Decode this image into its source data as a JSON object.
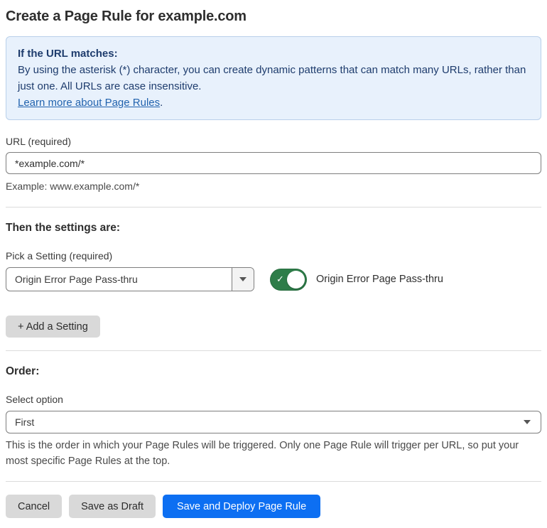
{
  "page": {
    "title": "Create a Page Rule for example.com"
  },
  "info_box": {
    "heading": "If the URL matches:",
    "body": "By using the asterisk (*) character, you can create dynamic patterns that can match many URLs, rather than just one. All URLs are case insensitive.",
    "link": "Learn more about Page Rules",
    "link_suffix": "."
  },
  "url_field": {
    "label": "URL (required)",
    "value": "*example.com/*",
    "helper": "Example: www.example.com/*"
  },
  "settings_section": {
    "heading": "Then the settings are:",
    "picker_label": "Pick a Setting (required)",
    "picker_value": "Origin Error Page Pass-thru",
    "toggle_label": "Origin Error Page Pass-thru",
    "toggle_state": "on",
    "toggle_check": "✓",
    "add_button": "+ Add a Setting"
  },
  "order_section": {
    "heading": "Order:",
    "select_label": "Select option",
    "select_value": "First",
    "helper": "This is the order in which your Page Rules will be triggered. Only one Page Rule will trigger per URL, so put your most specific Page Rules at the top."
  },
  "footer": {
    "cancel": "Cancel",
    "save_draft": "Save as Draft",
    "save_deploy": "Save and Deploy Page Rule"
  },
  "colors": {
    "accent_blue": "#0d6ff2",
    "toggle_green": "#2e7d49",
    "info_bg": "#e8f1fc",
    "info_border": "#b9d0ea",
    "info_text": "#1e3c6d",
    "link_blue": "#2263ae"
  }
}
